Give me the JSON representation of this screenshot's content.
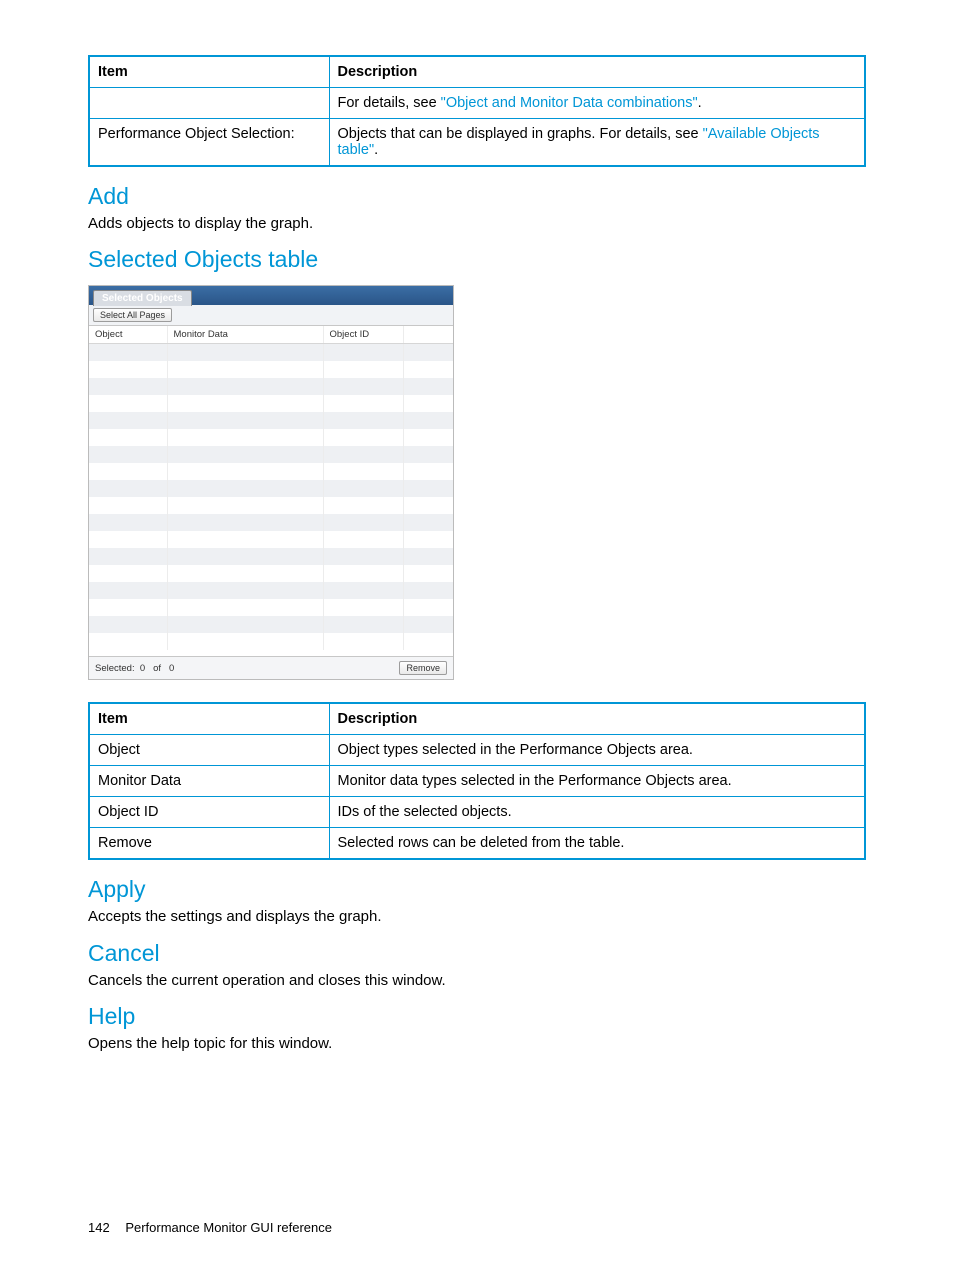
{
  "table1": {
    "h_item": "Item",
    "h_desc": "Description",
    "r1_desc_prefix": "For details, see ",
    "r1_link": "\"Object and Monitor Data combinations\"",
    "r1_suffix": ".",
    "r2_item": "Performance Object Selection:",
    "r2_desc_prefix": "Objects that can be displayed in graphs. For details, see ",
    "r2_link": "\"Available Objects table\"",
    "r2_suffix": "."
  },
  "add": {
    "heading": "Add",
    "text": "Adds objects to display the graph."
  },
  "selected_objects_heading": "Selected Objects table",
  "widget": {
    "tab_label": "Selected Objects",
    "select_all_btn": "Select All Pages",
    "col_object": "Object",
    "col_monitor": "Monitor Data",
    "col_oid": "Object ID",
    "selected_label": "Selected:",
    "selected_count": "0",
    "of_label": "of",
    "total_count": "0",
    "remove_btn": "Remove"
  },
  "table2": {
    "h_item": "Item",
    "h_desc": "Description",
    "rows": [
      {
        "item": "Object",
        "desc": "Object types selected in the Performance Objects area."
      },
      {
        "item": "Monitor Data",
        "desc": "Monitor data types selected in the Performance Objects area."
      },
      {
        "item": "Object ID",
        "desc": "IDs of the selected objects."
      },
      {
        "item": "Remove",
        "desc": "Selected rows can be deleted from the table."
      }
    ]
  },
  "apply": {
    "heading": "Apply",
    "text": "Accepts the settings and displays the graph."
  },
  "cancel": {
    "heading": "Cancel",
    "text": "Cancels the current operation and closes this window."
  },
  "help": {
    "heading": "Help",
    "text": "Opens the help topic for this window."
  },
  "footer": {
    "page_num": "142",
    "section": "Performance Monitor GUI reference"
  }
}
